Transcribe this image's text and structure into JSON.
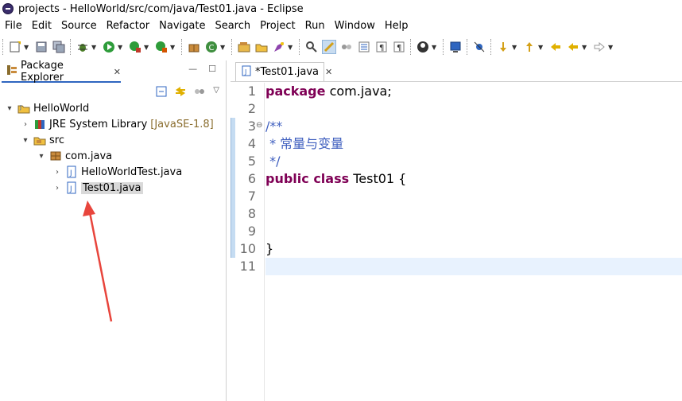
{
  "window": {
    "title": "projects - HelloWorld/src/com/java/Test01.java - Eclipse"
  },
  "menu": [
    "File",
    "Edit",
    "Source",
    "Refactor",
    "Navigate",
    "Search",
    "Project",
    "Run",
    "Window",
    "Help"
  ],
  "package_explorer": {
    "tab_label": "Package Explorer",
    "close_glyph": "✕",
    "tree": [
      {
        "label": "HelloWorld",
        "icon": "project-icon",
        "level": 0,
        "expanded": true
      },
      {
        "label": "JRE System Library",
        "decoration": "[JavaSE-1.8]",
        "icon": "library-icon",
        "level": 1,
        "expanded": false
      },
      {
        "label": "src",
        "icon": "source-folder-icon",
        "level": 1,
        "expanded": true
      },
      {
        "label": "com.java",
        "icon": "package-icon",
        "level": 2,
        "expanded": true
      },
      {
        "label": "HelloWorldTest.java",
        "icon": "java-file-icon",
        "level": 3,
        "expanded": false
      },
      {
        "label": "Test01.java",
        "icon": "java-file-icon",
        "level": 3,
        "expanded": false,
        "selected": true
      }
    ]
  },
  "editor": {
    "tab_label": "*Test01.java",
    "close_glyph": "✕",
    "line_numbers": [
      "1",
      "2",
      "3",
      "4",
      "5",
      "6",
      "7",
      "8",
      "9",
      "10",
      "11"
    ],
    "lines": [
      {
        "kw": "package",
        "text": " com.java;"
      },
      {
        "kw": "",
        "text": ""
      },
      {
        "cmt": "/**"
      },
      {
        "cmt": " * 常量与变量"
      },
      {
        "cmt": " */"
      },
      {
        "kw": "public class",
        "text": " Test01 {"
      },
      {
        "kw": "",
        "text": ""
      },
      {
        "kw": "",
        "text": ""
      },
      {
        "kw": "",
        "text": ""
      },
      {
        "kw": "",
        "text": "}"
      },
      {
        "kw": "",
        "text": ""
      }
    ],
    "fold_glyph": "⊖"
  },
  "colors": {
    "keyword": "#7f0055",
    "comment": "#3f5fbf",
    "current_line": "#e8f2fe",
    "annotation_arrow": "#e8453c"
  }
}
